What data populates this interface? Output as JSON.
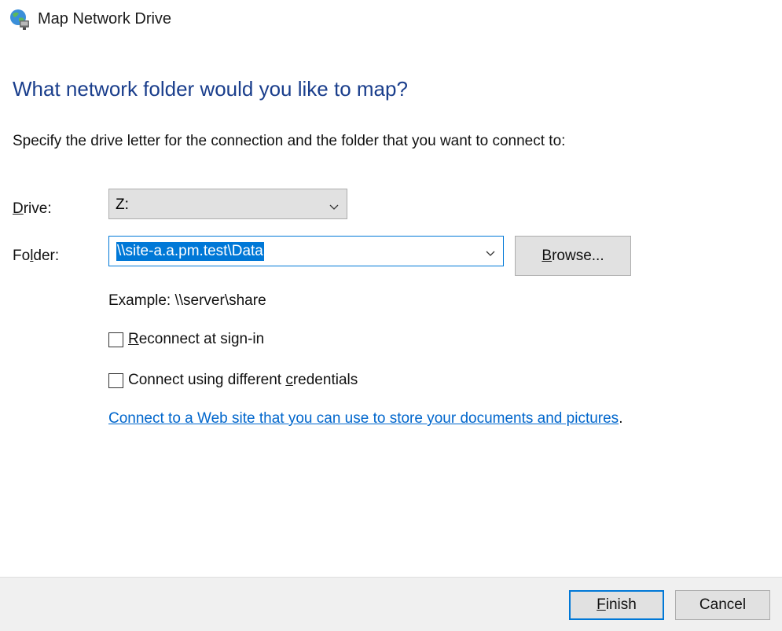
{
  "window": {
    "title": "Map Network Drive",
    "icon": "network-drive-icon"
  },
  "heading": "What network folder would you like to map?",
  "instructions": "Specify the drive letter for the connection and the folder that you want to connect to:",
  "drive": {
    "label_pre": "",
    "label_accel": "D",
    "label_post": "rive:",
    "value": "Z:"
  },
  "folder": {
    "label_pre": "Fo",
    "label_accel": "l",
    "label_post": "der:",
    "value": "\\\\site-a.a.pm.test\\Data",
    "browse_pre": "",
    "browse_accel": "B",
    "browse_post": "rowse..."
  },
  "example": "Example: \\\\server\\share",
  "reconnect": {
    "label_pre": "",
    "label_accel": "R",
    "label_post": "econnect at sign-in",
    "checked": false
  },
  "credentials": {
    "label_pre": "Connect using different ",
    "label_accel": "c",
    "label_post": "redentials",
    "checked": false
  },
  "weblink": {
    "text": "Connect to a Web site that you can use to store your documents and pictures",
    "suffix": "."
  },
  "footer": {
    "finish_pre": "",
    "finish_accel": "F",
    "finish_post": "inish",
    "cancel": "Cancel"
  },
  "colors": {
    "heading": "#1a3e8c",
    "accent": "#0078d7",
    "link": "#0066cc",
    "footer_bg": "#f0f0f0"
  }
}
